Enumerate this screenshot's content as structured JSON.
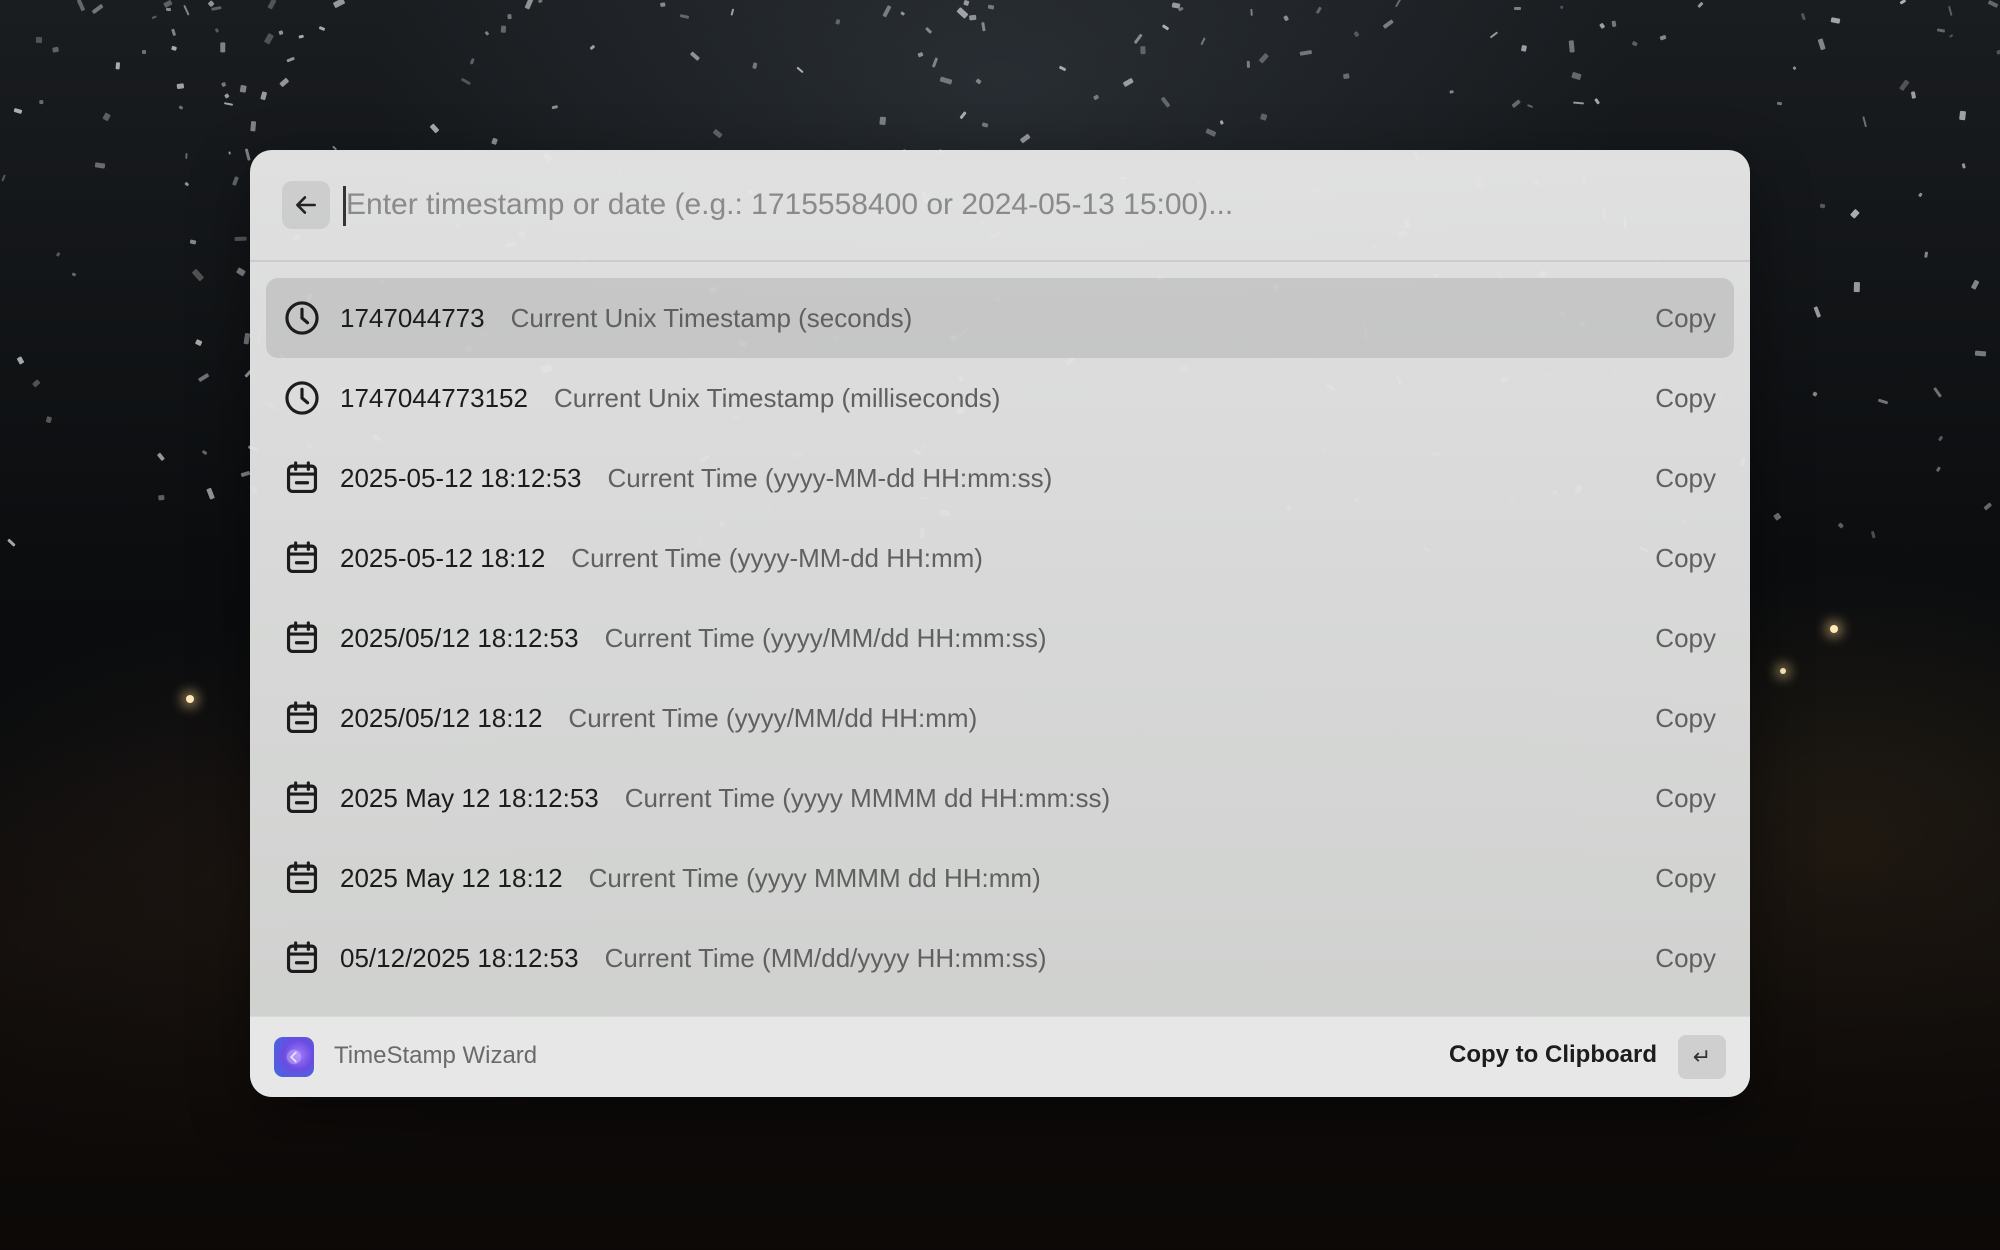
{
  "search": {
    "placeholder": "Enter timestamp or date (e.g.: 1715558400 or 2024-05-13 15:00)..."
  },
  "results": [
    {
      "icon": "clock-icon",
      "value": "1747044773",
      "description": "Current Unix Timestamp (seconds)",
      "action": "Copy",
      "selected": true
    },
    {
      "icon": "clock-icon",
      "value": "1747044773152",
      "description": "Current Unix Timestamp (milliseconds)",
      "action": "Copy"
    },
    {
      "icon": "calendar-icon",
      "value": "2025-05-12 18:12:53",
      "description": "Current Time (yyyy-MM-dd HH:mm:ss)",
      "action": "Copy"
    },
    {
      "icon": "calendar-icon",
      "value": "2025-05-12 18:12",
      "description": "Current Time (yyyy-MM-dd HH:mm)",
      "action": "Copy"
    },
    {
      "icon": "calendar-icon",
      "value": "2025/05/12 18:12:53",
      "description": "Current Time (yyyy/MM/dd HH:mm:ss)",
      "action": "Copy"
    },
    {
      "icon": "calendar-icon",
      "value": "2025/05/12 18:12",
      "description": "Current Time (yyyy/MM/dd HH:mm)",
      "action": "Copy"
    },
    {
      "icon": "calendar-icon",
      "value": "2025 May 12 18:12:53",
      "description": "Current Time (yyyy MMMM dd HH:mm:ss)",
      "action": "Copy"
    },
    {
      "icon": "calendar-icon",
      "value": "2025 May 12 18:12",
      "description": "Current Time (yyyy MMMM dd HH:mm)",
      "action": "Copy"
    },
    {
      "icon": "calendar-icon",
      "value": "05/12/2025 18:12:53",
      "description": "Current Time (MM/dd/yyyy HH:mm:ss)",
      "action": "Copy"
    }
  ],
  "footer": {
    "app_name": "TimeStamp Wizard",
    "action_label": "Copy to Clipboard",
    "action_key": "↵"
  }
}
